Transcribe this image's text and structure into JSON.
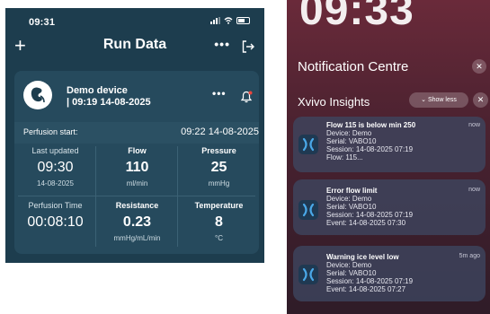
{
  "left_phone": {
    "status_time": "09:31",
    "nav": {
      "add_label": "+",
      "title": "Run Data",
      "more_label": "•••"
    },
    "device": {
      "name": "Demo device",
      "time": "| 09:19 14-08-2025",
      "more_label": "•••"
    },
    "perfusion": {
      "label": "Perfusion start:",
      "value": "09:22 14-08-2025"
    },
    "metrics": [
      {
        "label": "Last updated",
        "value": "09:30",
        "unit": "14-08-2025"
      },
      {
        "label": "Flow",
        "value": "110",
        "unit": "ml/min"
      },
      {
        "label": "Pressure",
        "value": "25",
        "unit": "mmHg"
      },
      {
        "label": "Perfusion Time",
        "value": "00:08:10",
        "unit": ""
      },
      {
        "label": "Resistance",
        "value": "0.23",
        "unit": "mmHg/mL/min"
      },
      {
        "label": "Temperature",
        "value": "8",
        "unit": "°C"
      }
    ],
    "colors": {
      "background": "#1d3d4e",
      "card": "#264a5d",
      "bell_badge": "#e8453c"
    }
  },
  "right_phone": {
    "lock_time": "09:33",
    "title": "Notification Centre",
    "group": {
      "app_name": "Xvivo Insights",
      "show_less": "Show less"
    },
    "notifications": [
      {
        "title": "Flow 115 is below min 250",
        "lines": [
          "Device: Demo",
          "Serial: VABO10",
          "Session: 14-08-2025 07:19",
          "Flow: 115..."
        ],
        "time": "now"
      },
      {
        "title": "Error flow limit",
        "lines": [
          "Device: Demo",
          "Serial: VABO10",
          "Session: 14-08-2025 07:19",
          "Event: 14-08-2025 07:30"
        ],
        "time": "now"
      },
      {
        "title": "Warning ice level low",
        "lines": [
          "Device: Demo",
          "Serial: VABO10",
          "Session: 14-08-2025 07:19",
          "Event: 14-08-2025 07:27"
        ],
        "time": "5m ago"
      }
    ],
    "icons": [
      "xvivo-logo-icon",
      "close-icon",
      "chevron-down-icon"
    ],
    "colors": {
      "accent": "#4aa8e8"
    }
  }
}
